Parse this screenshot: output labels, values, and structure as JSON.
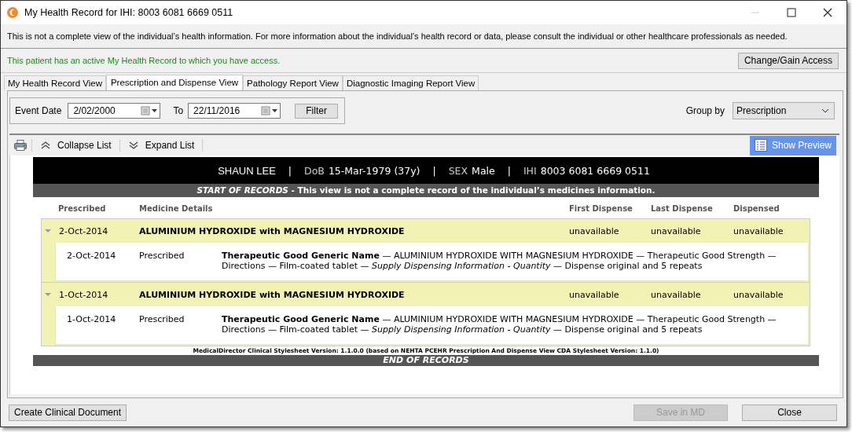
{
  "window": {
    "title": "My Health Record for IHI: 8003 6081 6669 0511"
  },
  "notice": "This is not a complete view of the individual’s health information. For more information about the individual’s health record or data, please consult the individual or other healthcare professionals as needed.",
  "access_status": "This patient has an active My Health Record to which you have access.",
  "access_button": "Change/Gain Access",
  "tabs": [
    {
      "label": "My Health Record View",
      "selected": false
    },
    {
      "label": "Prescription and Dispense View",
      "selected": true
    },
    {
      "label": "Pathology Report View",
      "selected": false
    },
    {
      "label": "Diagnostic Imaging Report View",
      "selected": false
    }
  ],
  "filter": {
    "event_date_label": "Event Date",
    "from": "2/02/2000",
    "to_label": "To",
    "to": "22/11/2016",
    "button": "Filter",
    "group_by_label": "Group by",
    "group_by": "Prescription"
  },
  "toolbar": {
    "collapse": "Collapse List",
    "expand": "Expand List",
    "preview": "Show Preview"
  },
  "report": {
    "patient_name": "SHAUN LEE",
    "patient": [
      {
        "label": "DoB",
        "value": "15-Mar-1979 (37y)"
      },
      {
        "label": "SEX",
        "value": "Male"
      },
      {
        "label": "IHI",
        "value": "8003 6081 6669 0511"
      }
    ],
    "separator": "|",
    "start_banner": "*START OF RECORDS* - This view is not a complete record of the individual’s medicines information.",
    "columns": [
      "Prescribed",
      "Medicine Details",
      "First Dispense",
      "Last Dispense",
      "Dispensed"
    ],
    "groups": [
      {
        "date": "2-Oct-2014",
        "medicine": "ALUMINIUM HYDROXIDE with MAGNESIUM HYDROXIDE",
        "first_dispense": "unavailable",
        "last_dispense": "unavailable",
        "dispensed": "unavailable",
        "expanded": true,
        "items": [
          {
            "date": "2-Oct-2014",
            "status": "Prescribed",
            "details": "**Therapeutic Good Generic Name** — ALUMINIUM HYDROXIDE WITH MAGNESIUM HYDROXIDE — Therapeutic Good Strength — Directions — Film-coated tablet — *Supply Dispensing Information - Quantity* — Dispense original and 5 repeats"
          }
        ]
      },
      {
        "date": "1-Oct-2014",
        "medicine": "ALUMINIUM HYDROXIDE with MAGNESIUM HYDROXIDE",
        "first_dispense": "unavailable",
        "last_dispense": "unavailable",
        "dispensed": "unavailable",
        "expanded": true,
        "items": [
          {
            "date": "1-Oct-2014",
            "status": "Prescribed",
            "details": "**Therapeutic Good Generic Name** — ALUMINIUM HYDROXIDE WITH MAGNESIUM HYDROXIDE — Therapeutic Good Strength — Directions — Film-coated tablet — *Supply Dispensing Information - Quantity* — Dispense original and 5 repeats"
          }
        ]
      }
    ],
    "stylesheet_note": "MedicalDirector Clinical Stylesheet Version: 1.1.0.0 (based on NEHTA PCEHR Prescription And Dispense View CDA Stylesheet Version: 1.1.0)",
    "end_banner": "END OF RECORDS"
  },
  "footer": {
    "buttons": [
      {
        "label": "Create Clinical Document",
        "disabled": false
      },
      {
        "label": "Save in MD",
        "disabled": true
      },
      {
        "label": "Close",
        "disabled": false
      }
    ]
  }
}
